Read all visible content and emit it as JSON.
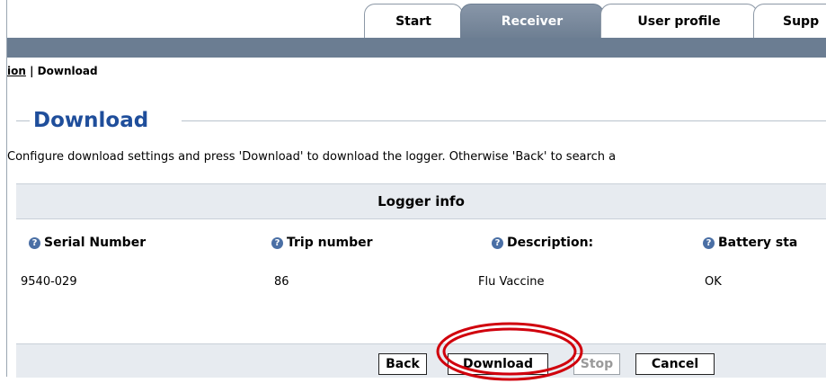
{
  "tabs": [
    {
      "label": "Start",
      "active": false
    },
    {
      "label": "Receiver",
      "active": true
    },
    {
      "label": "User profile",
      "active": false
    },
    {
      "label": "Supp",
      "active": false
    }
  ],
  "breadcrumb": {
    "link_label": "ion",
    "separator": " | ",
    "current": "Download"
  },
  "page": {
    "title": "Download",
    "instructions": "Configure download settings and press 'Download' to download the logger. Otherwise 'Back' to search a"
  },
  "logger_info": {
    "title": "Logger info",
    "columns": [
      {
        "label": "Serial Number",
        "icon": "help-icon"
      },
      {
        "label": "Trip number",
        "icon": "help-icon"
      },
      {
        "label": "Description:",
        "icon": "help-icon"
      },
      {
        "label": "Battery sta",
        "icon": "help-icon"
      }
    ],
    "values": [
      "9540-029",
      "86",
      "Flu Vaccine",
      "OK"
    ]
  },
  "buttons": {
    "back": "Back",
    "download": "Download",
    "stop": "Stop",
    "cancel": "Cancel"
  },
  "colors": {
    "header_bar": "#6b7d92",
    "title": "#1f4e9b",
    "highlight_ring": "#d0000c"
  }
}
